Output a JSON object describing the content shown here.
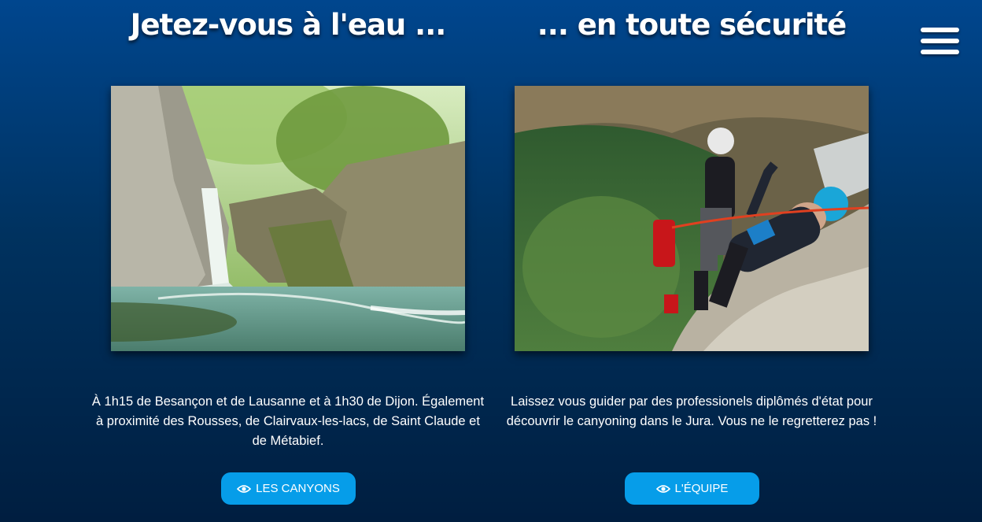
{
  "nav": {
    "menu_icon": "hamburger-menu-icon"
  },
  "sections": [
    {
      "title": "Jetez-vous à l'eau ...",
      "image_icon": "canyon-waterfall-photo",
      "description": "À 1h15 de Besançon et de Lausanne et à 1h30 de Dijon. Également à proximité des Rousses, de Clairvaux-les-lacs, de Saint Claude et de Métabief.",
      "button_label": "LES CANYONS",
      "button_icon": "eye-icon"
    },
    {
      "title": "... en toute sécurité",
      "image_icon": "canyoning-guides-photo",
      "description": "Laissez vous guider par des professionels diplômés d'état pour découvrir le canyoning dans le Jura. Vous ne le regretterez pas !",
      "button_label": "L'ÉQUIPE",
      "button_icon": "eye-icon"
    }
  ],
  "colors": {
    "background_top": "#00468e",
    "background_bottom": "#001e40",
    "button": "#069de9",
    "text": "#ffffff"
  }
}
